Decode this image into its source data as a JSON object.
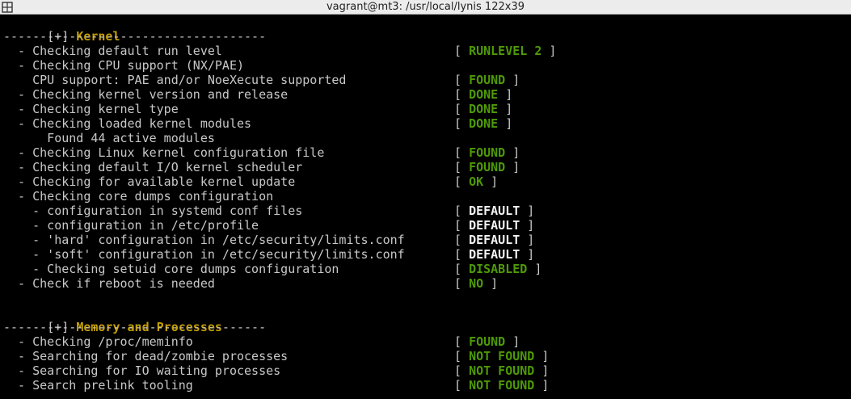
{
  "window": {
    "title": "vagrant@mt3: /usr/local/lynis 122x39"
  },
  "sections": {
    "kernel": {
      "bracket": "[+]",
      "title": "Kernel",
      "divider": "------------------------------------",
      "items": [
        {
          "text": "  - Checking default run level",
          "status": "RUNLEVEL 2"
        },
        {
          "text": "  - Checking CPU support (NX/PAE)",
          "status": ""
        },
        {
          "text": "    CPU support: PAE and/or NoeXecute supported",
          "status": "FOUND"
        },
        {
          "text": "  - Checking kernel version and release",
          "status": "DONE"
        },
        {
          "text": "  - Checking kernel type",
          "status": "DONE"
        },
        {
          "text": "  - Checking loaded kernel modules",
          "status": "DONE"
        },
        {
          "text": "      Found 44 active modules",
          "status": ""
        },
        {
          "text": "  - Checking Linux kernel configuration file",
          "status": "FOUND"
        },
        {
          "text": "  - Checking default I/O kernel scheduler",
          "status": "FOUND"
        },
        {
          "text": "  - Checking for available kernel update",
          "status": "OK"
        },
        {
          "text": "  - Checking core dumps configuration",
          "status": ""
        },
        {
          "text": "    - configuration in systemd conf files",
          "status": "DEFAULT"
        },
        {
          "text": "    - configuration in /etc/profile",
          "status": "DEFAULT"
        },
        {
          "text": "    - 'hard' configuration in /etc/security/limits.conf",
          "status": "DEFAULT"
        },
        {
          "text": "    - 'soft' configuration in /etc/security/limits.conf",
          "status": "DEFAULT"
        },
        {
          "text": "    - Checking setuid core dumps configuration",
          "status": "DISABLED"
        },
        {
          "text": "  - Check if reboot is needed",
          "status": "NO"
        }
      ]
    },
    "memory": {
      "bracket": "[+]",
      "title": "Memory and Processes",
      "divider": "------------------------------------",
      "items": [
        {
          "text": "  - Checking /proc/meminfo",
          "status": "FOUND"
        },
        {
          "text": "  - Searching for dead/zombie processes",
          "status": "NOT FOUND"
        },
        {
          "text": "  - Searching for IO waiting processes",
          "status": "NOT FOUND"
        },
        {
          "text": "  - Search prelink tooling",
          "status": "NOT FOUND"
        }
      ]
    }
  },
  "status_colors": {
    "green": "#4e9a06",
    "white": "#f2f2f2",
    "title": "#c4a000"
  }
}
